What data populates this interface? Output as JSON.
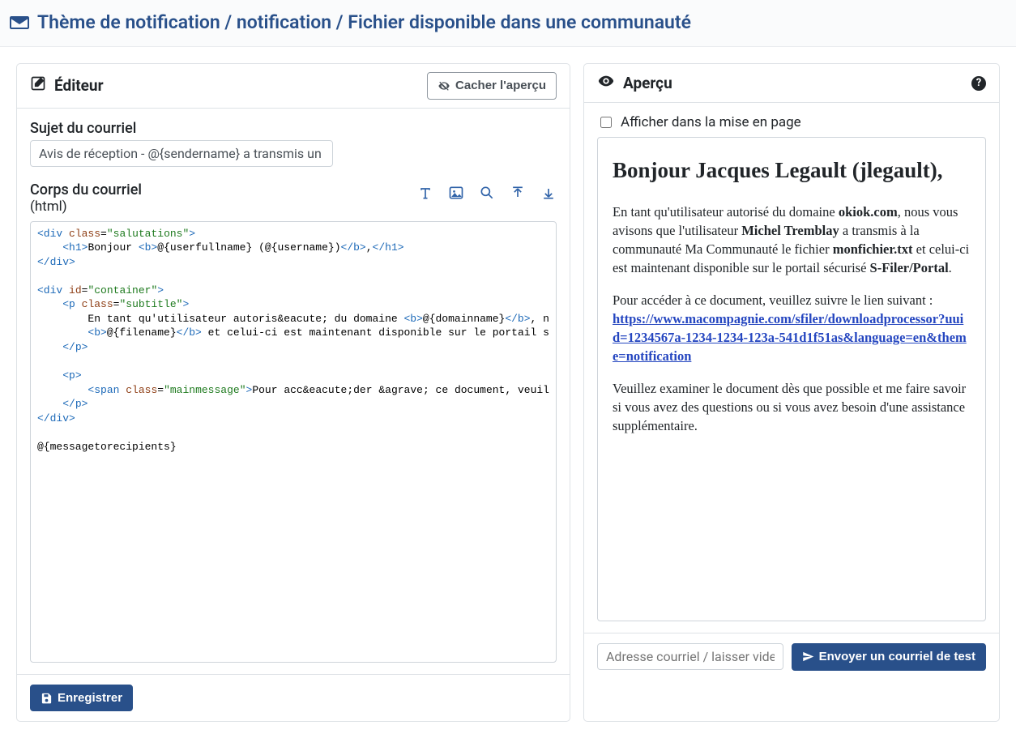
{
  "breadcrumb": "Thème de notification / notification / Fichier disponible dans une communauté",
  "editor": {
    "title": "Éditeur",
    "hide_preview_label": "Cacher l'aperçu",
    "subject_label": "Sujet du courriel",
    "subject_value": "Avis de réception - @{sendername} a transmis un fich",
    "body_label": "Corps du courriel",
    "body_format": "(html)",
    "code_lines": [
      {
        "segments": [
          {
            "t": "<div",
            "c": "tag"
          },
          {
            "t": " ",
            "c": "plain"
          },
          {
            "t": "class",
            "c": "attr"
          },
          {
            "t": "=",
            "c": "plain"
          },
          {
            "t": "\"salutations\"",
            "c": "val"
          },
          {
            "t": ">",
            "c": "tag"
          }
        ]
      },
      {
        "indent": 1,
        "segments": [
          {
            "t": "<h1>",
            "c": "tag"
          },
          {
            "t": "Bonjour ",
            "c": "plain"
          },
          {
            "t": "<b>",
            "c": "tag"
          },
          {
            "t": "@{userfullname} (@{username})",
            "c": "plain"
          },
          {
            "t": "</b>",
            "c": "tag"
          },
          {
            "t": ",",
            "c": "plain"
          },
          {
            "t": "</h1>",
            "c": "tag"
          }
        ]
      },
      {
        "segments": [
          {
            "t": "</div>",
            "c": "tag"
          }
        ]
      },
      {
        "segments": [
          {
            "t": "",
            "c": "plain"
          }
        ]
      },
      {
        "segments": [
          {
            "t": "<div",
            "c": "tag"
          },
          {
            "t": " ",
            "c": "plain"
          },
          {
            "t": "id",
            "c": "attr"
          },
          {
            "t": "=",
            "c": "plain"
          },
          {
            "t": "\"container\"",
            "c": "val"
          },
          {
            "t": ">",
            "c": "tag"
          }
        ]
      },
      {
        "indent": 1,
        "segments": [
          {
            "t": "<p",
            "c": "tag"
          },
          {
            "t": " ",
            "c": "plain"
          },
          {
            "t": "class",
            "c": "attr"
          },
          {
            "t": "=",
            "c": "plain"
          },
          {
            "t": "\"subtitle\"",
            "c": "val"
          },
          {
            "t": ">",
            "c": "tag"
          }
        ]
      },
      {
        "indent": 2,
        "segments": [
          {
            "t": "En tant qu'utilisateur autoris&eacute; du domaine ",
            "c": "plain"
          },
          {
            "t": "<b>",
            "c": "tag"
          },
          {
            "t": "@{domainname}",
            "c": "plain"
          },
          {
            "t": "</b>",
            "c": "tag"
          },
          {
            "t": ", n",
            "c": "plain"
          }
        ]
      },
      {
        "indent": 2,
        "segments": [
          {
            "t": "<b>",
            "c": "tag"
          },
          {
            "t": "@{filename}",
            "c": "plain"
          },
          {
            "t": "</b>",
            "c": "tag"
          },
          {
            "t": " et celui-ci est maintenant disponible sur le portail s",
            "c": "plain"
          }
        ]
      },
      {
        "indent": 1,
        "segments": [
          {
            "t": "</p>",
            "c": "tag"
          }
        ]
      },
      {
        "segments": [
          {
            "t": "",
            "c": "plain"
          }
        ]
      },
      {
        "indent": 1,
        "segments": [
          {
            "t": "<p>",
            "c": "tag"
          }
        ]
      },
      {
        "indent": 2,
        "segments": [
          {
            "t": "<span",
            "c": "tag"
          },
          {
            "t": " ",
            "c": "plain"
          },
          {
            "t": "class",
            "c": "attr"
          },
          {
            "t": "=",
            "c": "plain"
          },
          {
            "t": "\"mainmessage\"",
            "c": "val"
          },
          {
            "t": ">",
            "c": "tag"
          },
          {
            "t": "Pour acc&eacute;der &agrave; ce document, veuil",
            "c": "plain"
          }
        ]
      },
      {
        "indent": 1,
        "segments": [
          {
            "t": "</p>",
            "c": "tag"
          }
        ]
      },
      {
        "segments": [
          {
            "t": "</div>",
            "c": "tag"
          }
        ]
      },
      {
        "segments": [
          {
            "t": "",
            "c": "plain"
          }
        ]
      },
      {
        "segments": [
          {
            "t": "@{messagetorecipients}",
            "c": "plain"
          }
        ]
      }
    ],
    "save_label": "Enregistrer"
  },
  "preview": {
    "title": "Aperçu",
    "show_layout_label": "Afficher dans la mise en page",
    "greeting": "Bonjour Jacques Legault (jlegault),",
    "p1_prefix": "En tant qu'utilisateur autorisé du domaine ",
    "domain": "okiok.com",
    "p1_mid1": ", nous vous avisons que l'utilisateur ",
    "sender": "Michel Tremblay",
    "p1_mid2": " a transmis à la communauté Ma Communauté le fichier ",
    "filename": "monfichier.txt",
    "p1_mid3": " et celui-ci est maintenant disponible sur le portail sécurisé ",
    "portal": "S-Filer/Portal",
    "p1_suffix": ".",
    "p2": "Pour accéder à ce document, veuillez suivre le lien suivant :",
    "link": "https://www.macompagnie.com/sfiler/downloadprocessor?uuid=1234567a-1234-1234-123a-541d1f51as&language=en&theme=notification",
    "p3": "Veuillez examiner le document dès que possible et me faire savoir si vous avez des questions ou si vous avez besoin d'une assistance supplémentaire.",
    "email_placeholder": "Adresse courriel / laisser vide pour envoyer à votre adr",
    "send_test_label": "Envoyer un courriel de test"
  }
}
